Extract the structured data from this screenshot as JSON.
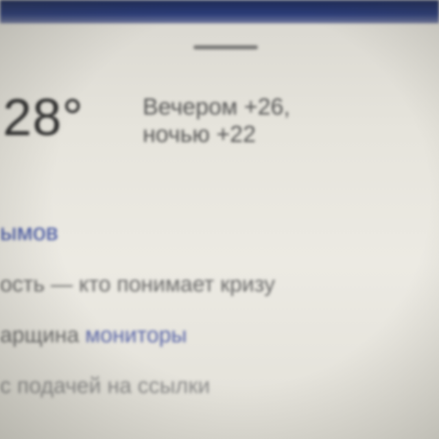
{
  "weather": {
    "temperature": "28°",
    "evening": "Вечером +26,",
    "night": "ночью +22"
  },
  "results": {
    "link_text": "ымов",
    "line1_plain": "ость — кто понимает кризу",
    "line2_plain": "арщина",
    "line2_link": "мониторы",
    "line3": "с подачей на ссылки"
  }
}
